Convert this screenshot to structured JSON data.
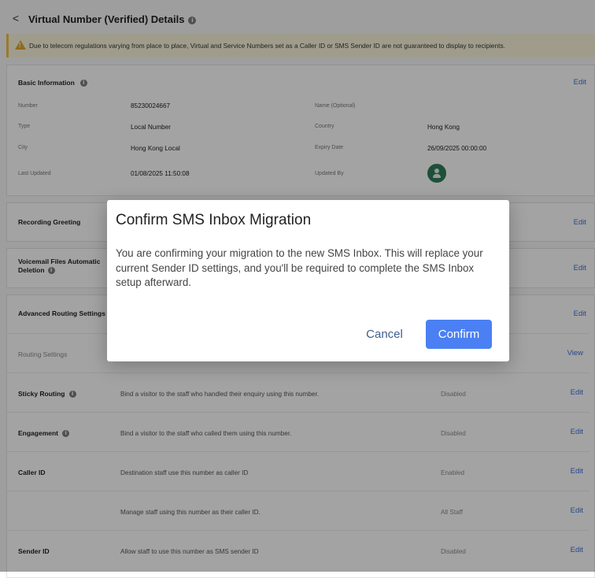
{
  "header": {
    "back_label": "<",
    "title": "Virtual Number (Verified) Details"
  },
  "warning": {
    "text": "Due to telecom regulations varying from place to place, Virtual and Service Numbers set as a Caller ID or SMS Sender ID are not guaranteed to display to recipients."
  },
  "basic_info": {
    "title": "Basic Information",
    "edit_label": "Edit",
    "fields": [
      {
        "label": "Number",
        "value": "85230024667"
      },
      {
        "label": "Name (Optional)",
        "value": ""
      },
      {
        "label": "Type",
        "value": "Local Number"
      },
      {
        "label": "Country",
        "value": "Hong Kong"
      },
      {
        "label": "City",
        "value": "Hong Kong Local"
      },
      {
        "label": "Expiry Date",
        "value": "26/09/2025 00:00:00"
      },
      {
        "label": "Last Updated",
        "value": "01/08/2025 11:50:08"
      },
      {
        "label": "Updated By",
        "value": ""
      }
    ]
  },
  "recording_greeting": {
    "title": "Recording Greeting",
    "edit_label": "Edit"
  },
  "voicemail": {
    "title_line1": "Voicemail Files Automatic",
    "title_line2": "Deletion",
    "edit_label": "Edit"
  },
  "advanced": {
    "title": "Advanced Routing Settings",
    "edit_label": "Edit",
    "rows": [
      {
        "label": "Routing Settings",
        "desc": "",
        "status": "",
        "action": "View"
      },
      {
        "label": "Sticky Routing",
        "desc": "Bind a visitor to the staff who handled their enquiry using this number.",
        "status": "Disabled",
        "action": "Edit"
      },
      {
        "label": "Engagement",
        "desc": "Bind a visitor to the staff who called them using this number.",
        "status": "Disabled",
        "action": "Edit"
      },
      {
        "label": "Caller ID",
        "desc": "Destination staff use this number as caller ID",
        "status": "Enabled",
        "action": "Edit"
      },
      {
        "label": "",
        "desc": "Manage staff using this number as their caller ID.",
        "status": "All Staff",
        "action": "Edit"
      },
      {
        "label": "Sender ID",
        "desc": "Allow staff to use this number as SMS sender ID",
        "status": "Disabled",
        "action": "Edit"
      }
    ]
  },
  "modal": {
    "title": "Confirm SMS Inbox Migration",
    "body": "You are confirming your migration to the new SMS Inbox. This will replace your current Sender ID settings, and you'll be required to complete the SMS Inbox setup afterward.",
    "cancel_label": "Cancel",
    "confirm_label": "Confirm"
  },
  "colors": {
    "accent": "#4a80f3",
    "link": "#3f6fd8",
    "warning_bg": "#fbf4dc",
    "avatar": "#2f7d5a"
  },
  "icons": [
    "back-icon",
    "info-icon",
    "warning-icon",
    "avatar-icon"
  ]
}
